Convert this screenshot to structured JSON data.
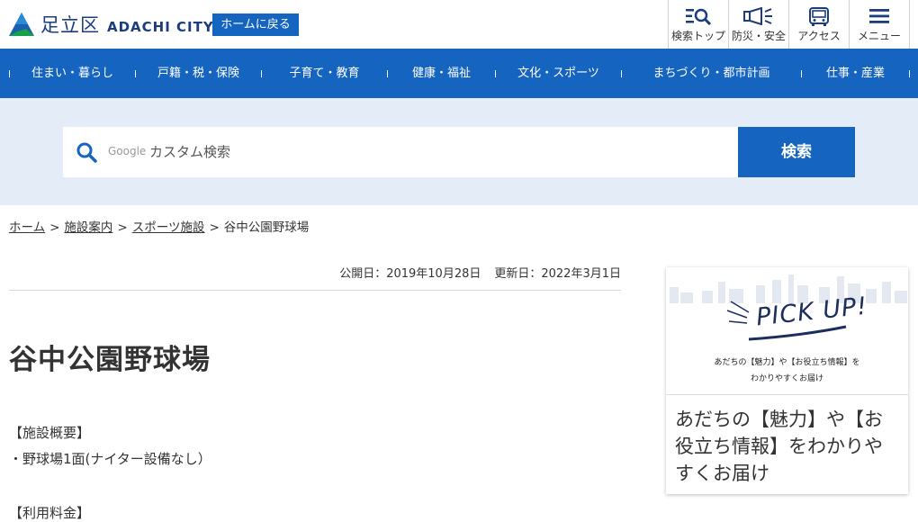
{
  "header": {
    "logo_kanji": "足立区",
    "logo_roman": "ADACHI CITY",
    "home_button": "ホームに戻る",
    "tools": [
      {
        "label": "検索トップ",
        "icon": "search-list-icon"
      },
      {
        "label": "防災・安全",
        "icon": "megaphone-icon"
      },
      {
        "label": "アクセス",
        "icon": "bus-icon"
      },
      {
        "label": "メニュー",
        "icon": "hamburger-menu-icon"
      }
    ]
  },
  "nav": {
    "items": [
      "住まい・暮らし",
      "戸籍・税・保険",
      "子育て・教育",
      "健康・福祉",
      "文化・スポーツ",
      "まちづくり・都市計画",
      "仕事・産業"
    ]
  },
  "search": {
    "google_label": "Google",
    "placeholder": "カスタム検索",
    "button": "検索"
  },
  "breadcrumb": {
    "items": [
      "ホーム",
      "施設案内",
      "スポーツ施設"
    ],
    "current": "谷中公園野球場",
    "separator": ">"
  },
  "page": {
    "published": "公開日：2019年10月28日",
    "updated": "更新日：2022年3月1日",
    "title": "谷中公園野球場",
    "section1_heading": "【施設概要】",
    "section1_item": "・野球場1面(ナイター設備なし）",
    "section2_heading": "【利用料金】"
  },
  "card": {
    "image_title": "PICK UP!",
    "image_line1": "あだちの【魅力】や【お役立ち情報】を",
    "image_line2": "わかりやすくお届け",
    "text": "あだちの【魅力】や【お役立ち情報】をわかりやすくお届け"
  },
  "colors": {
    "brand_blue": "#1565c0",
    "search_band": "#e4ecf7",
    "logo_navy": "#1b3d7e"
  }
}
